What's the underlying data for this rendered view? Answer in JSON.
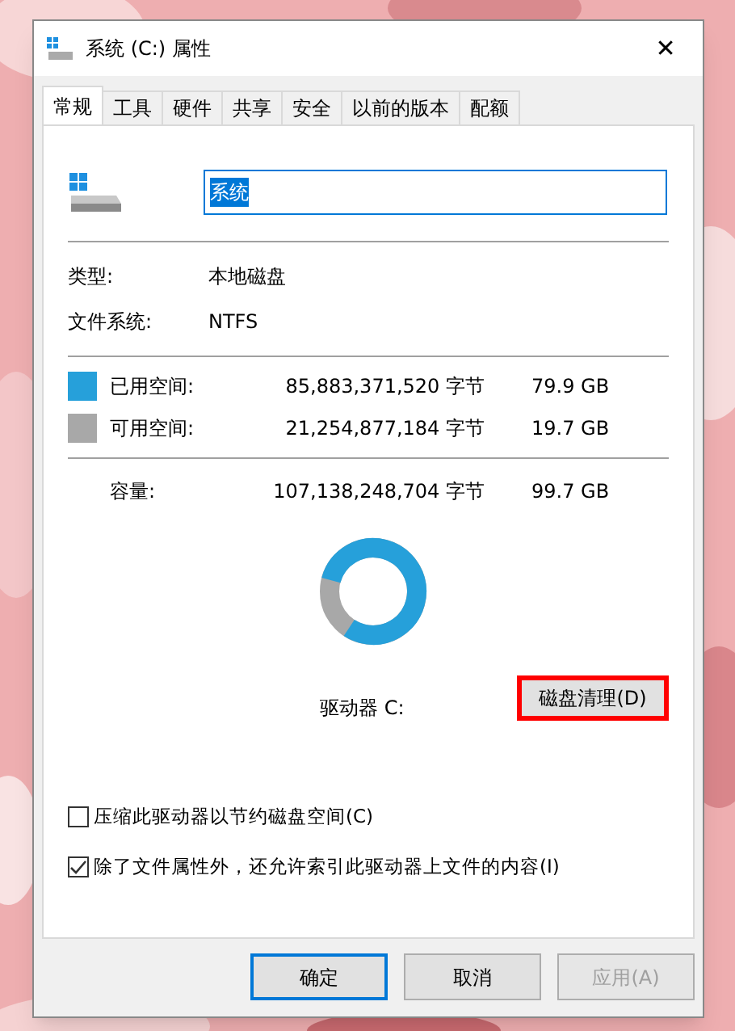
{
  "window": {
    "title": "系统 (C:) 属性",
    "close": "✕"
  },
  "tabs": [
    {
      "label": "常规",
      "selected": true
    },
    {
      "label": "工具",
      "selected": false
    },
    {
      "label": "硬件",
      "selected": false
    },
    {
      "label": "共享",
      "selected": false
    },
    {
      "label": "安全",
      "selected": false
    },
    {
      "label": "以前的版本",
      "selected": false
    },
    {
      "label": "配额",
      "selected": false
    }
  ],
  "name_field": {
    "value": "系统",
    "selected": true
  },
  "info": [
    {
      "label": "类型:",
      "value": "本地磁盘"
    },
    {
      "label": "文件系统:",
      "value": "NTFS"
    }
  ],
  "space": [
    {
      "label": "已用空间:",
      "bytes": "85,883,371,520 字节",
      "size": "79.9 GB",
      "color": "#26a0da"
    },
    {
      "label": "可用空间:",
      "bytes": "21,254,877,184 字节",
      "size": "19.7 GB",
      "color": "#a8a8a8"
    }
  ],
  "capacity": {
    "label": "容量:",
    "bytes": "107,138,248,704 字节",
    "size": "99.7 GB"
  },
  "drive_label": "驱动器 C:",
  "cleanup_button": {
    "label": "磁盘清理(D)",
    "highlighted": true
  },
  "options": [
    {
      "label": "压缩此驱动器以节约磁盘空间(C)",
      "checked": false
    },
    {
      "label": "除了文件属性外，还允许索引此驱动器上文件的内容(I)",
      "checked": true
    }
  ],
  "buttons": [
    {
      "label": "确定",
      "default": true,
      "disabled": false
    },
    {
      "label": "取消",
      "default": false,
      "disabled": false
    },
    {
      "label": "应用(A)",
      "default": false,
      "disabled": true
    }
  ]
}
